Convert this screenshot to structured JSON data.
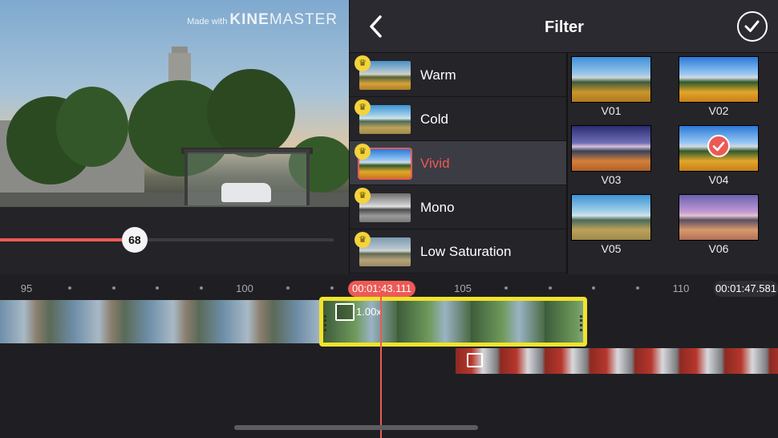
{
  "watermark": {
    "made_with": "Made with",
    "brand_a": "KINE",
    "brand_b": "MASTER"
  },
  "slider": {
    "value": "68",
    "fraction": 0.68
  },
  "panel": {
    "title": "Filter",
    "back_icon": "chevron-left-icon",
    "done_icon": "check-circle-icon",
    "categories": [
      {
        "label": "Warm",
        "selected": false,
        "premium": true
      },
      {
        "label": "Cold",
        "selected": false,
        "premium": true
      },
      {
        "label": "Vivid",
        "selected": true,
        "premium": true
      },
      {
        "label": "Mono",
        "selected": false,
        "premium": true
      },
      {
        "label": "Low Saturation",
        "selected": false,
        "premium": true
      }
    ],
    "filters": [
      {
        "label": "V01",
        "selected": false
      },
      {
        "label": "V02",
        "selected": false
      },
      {
        "label": "V03",
        "selected": false
      },
      {
        "label": "V04",
        "selected": true
      },
      {
        "label": "V05",
        "selected": false
      },
      {
        "label": "V06",
        "selected": false
      }
    ]
  },
  "timeline": {
    "ticks": [
      "95",
      "100",
      "105",
      "110"
    ],
    "current_time": "00:01:43.111",
    "end_time": "00:01:47.581",
    "clip_speed": "1.00x"
  },
  "colors": {
    "accent": "#ec5a55",
    "selection": "#f2e32b",
    "premium": "#f4d33c"
  }
}
